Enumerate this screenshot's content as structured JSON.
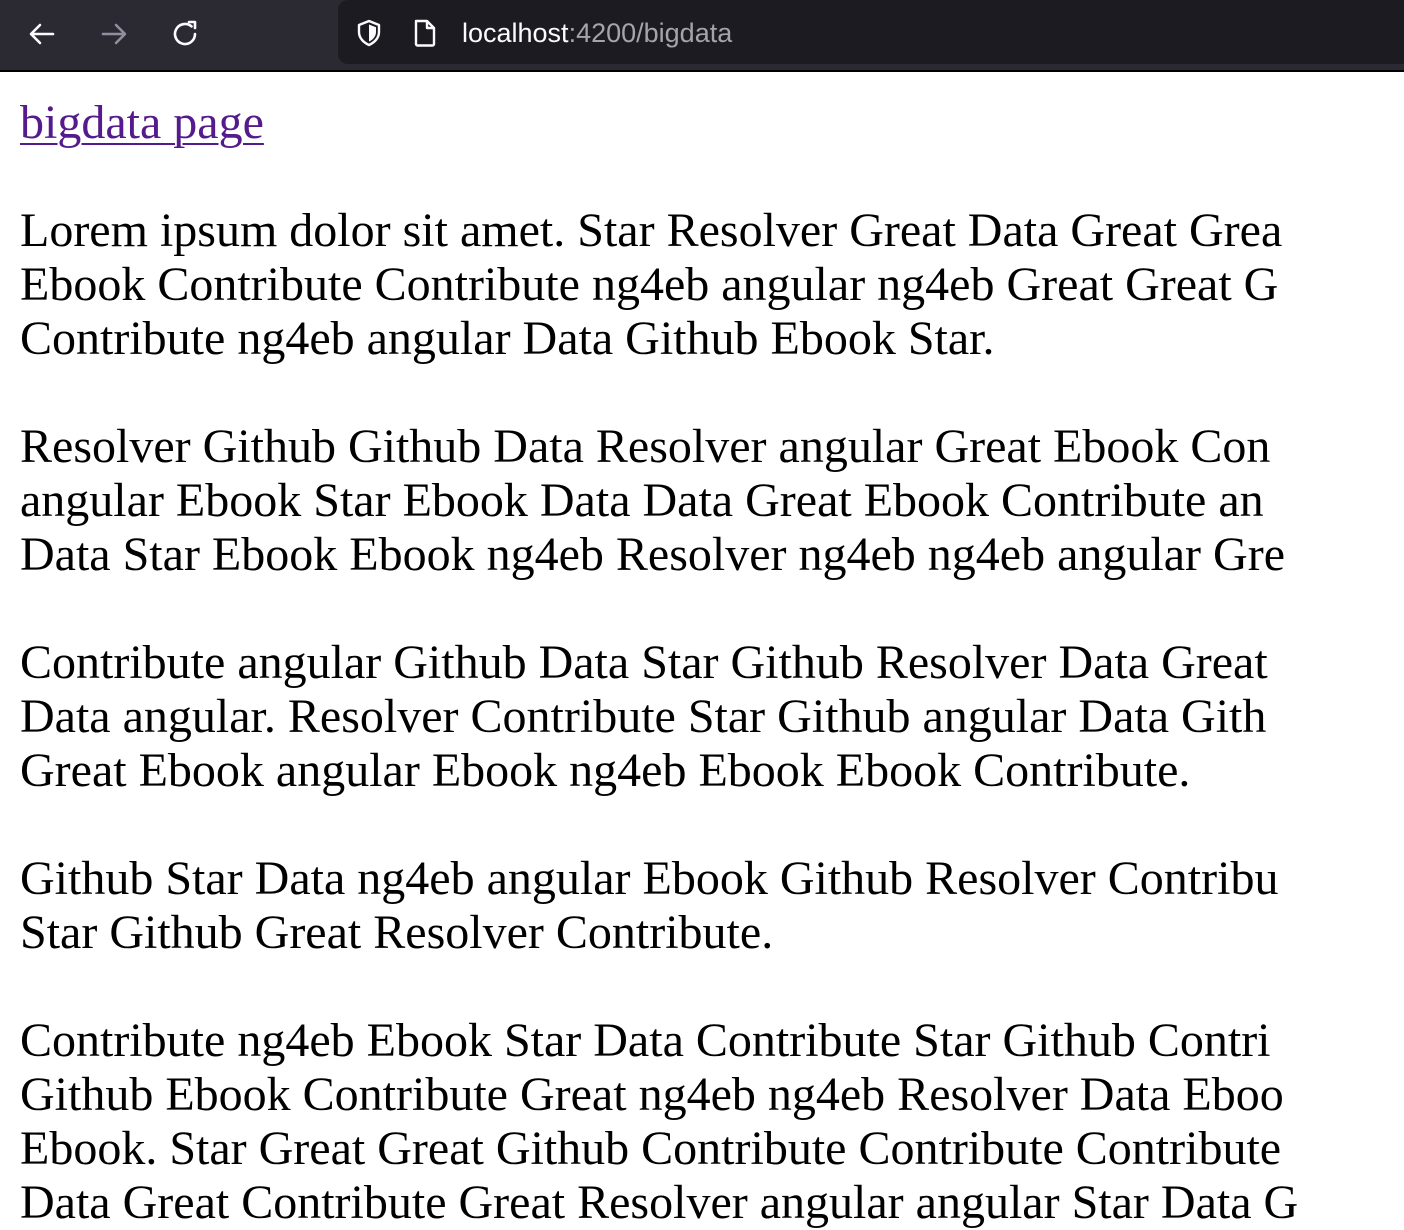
{
  "browser": {
    "url_host": "localhost",
    "url_rest": ":4200/bigdata",
    "icons": {
      "back": "arrow-left-icon",
      "forward": "arrow-right-icon",
      "reload": "reload-icon",
      "security": "shield-icon",
      "page": "page-icon"
    },
    "colors": {
      "toolbar": "#2b2a33",
      "urlbar": "#1c1b22",
      "link": "#551a8b"
    }
  },
  "page": {
    "link_text": "bigdata page",
    "paragraphs": [
      {
        "lines": [
          "Lorem ipsum dolor sit amet. Star Resolver Great Data Great Grea",
          "Ebook Contribute Contribute ng4eb angular ng4eb Great Great G",
          "Contribute ng4eb angular Data Github Ebook Star."
        ]
      },
      {
        "lines": [
          "Resolver Github Github Data Resolver angular Great Ebook Con",
          "angular Ebook Star Ebook Data Data Great Ebook Contribute an",
          "Data Star Ebook Ebook ng4eb Resolver ng4eb ng4eb angular Gre"
        ]
      },
      {
        "lines": [
          "Contribute angular Github Data Star Github Resolver Data Great",
          "Data angular. Resolver Contribute Star Github angular Data Gith",
          "Great Ebook angular Ebook ng4eb Ebook Ebook Contribute."
        ]
      },
      {
        "lines": [
          "Github Star Data ng4eb angular Ebook Github Resolver Contribu",
          "Star Github Great Resolver Contribute."
        ]
      },
      {
        "lines": [
          "Contribute ng4eb Ebook Star Data Contribute Star Github Contri",
          "Github Ebook Contribute Great ng4eb ng4eb Resolver Data Eboo",
          "Ebook. Star Great Great Github Contribute Contribute Contribute",
          "Data Great Contribute Great Resolver angular angular Star Data G"
        ]
      }
    ]
  }
}
